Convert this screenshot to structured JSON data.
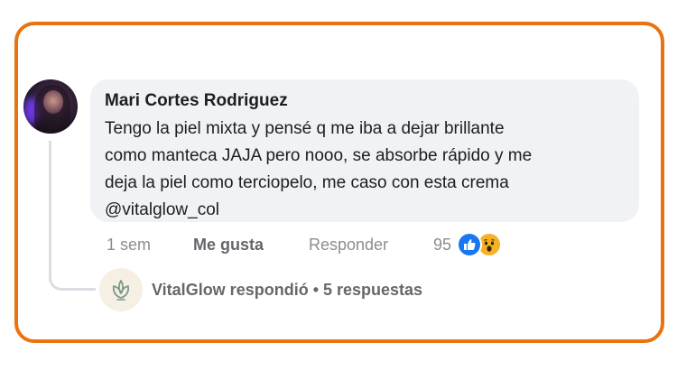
{
  "comment": {
    "author": "Mari Cortes Rodriguez",
    "text_lines": [
      "Tengo la piel mixta y pensé q me iba a dejar brillante",
      "como manteca JAJA pero nooo, se absorbe rápido y me",
      "deja la piel como terciopelo, me caso con esta crema",
      "@vitalglow_col"
    ],
    "time": "1 sem",
    "like_label": "Me gusta",
    "reply_label": "Responder",
    "reaction_count": "95",
    "reactions": [
      "like-icon",
      "wow-icon"
    ]
  },
  "reply_thread": {
    "summary": "VitalGlow respondió • 5 respuestas",
    "avatar_icon": "leaf-logo-icon"
  },
  "colors": {
    "frame": "#e8730f",
    "bubble": "#f0f2f5",
    "like_blue": "#1877f2",
    "wow_yellow": "#f7b125"
  }
}
